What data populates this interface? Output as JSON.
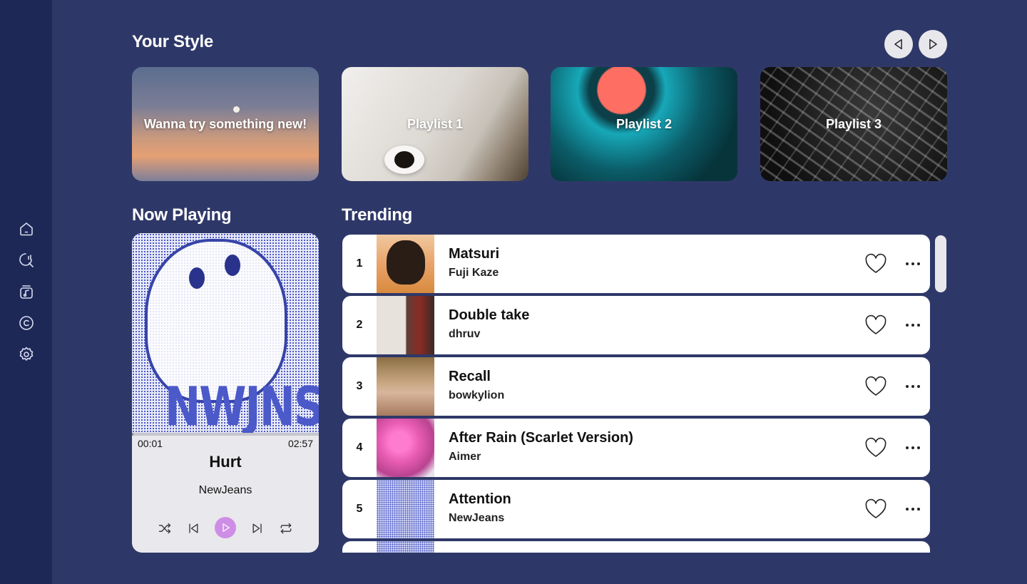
{
  "sidebar": {
    "items": [
      {
        "icon": "home-icon"
      },
      {
        "icon": "search-icon"
      },
      {
        "icon": "music-library-icon"
      },
      {
        "icon": "copyright-icon"
      },
      {
        "icon": "settings-icon"
      }
    ]
  },
  "your_style": {
    "title": "Your Style",
    "cards": [
      {
        "label": "Wanna try something new!"
      },
      {
        "label": "Playlist 1"
      },
      {
        "label": "Playlist 2"
      },
      {
        "label": "Playlist 3"
      }
    ]
  },
  "now_playing": {
    "title": "Now Playing",
    "album_text": "NWJNS",
    "current_time": "00:01",
    "duration": "02:57",
    "progress": 0.006,
    "track": "Hurt",
    "artist": "NewJeans"
  },
  "trending": {
    "title": "Trending",
    "rows": [
      {
        "rank": "1",
        "title": "Matsuri",
        "artist": "Fuji Kaze"
      },
      {
        "rank": "2",
        "title": "Double take",
        "artist": "dhruv"
      },
      {
        "rank": "3",
        "title": "Recall",
        "artist": "bowkylion"
      },
      {
        "rank": "4",
        "title": "After Rain (Scarlet Version)",
        "artist": "Aimer"
      },
      {
        "rank": "5",
        "title": "Attention",
        "artist": "NewJeans"
      },
      {
        "rank": "",
        "title": "",
        "artist": ""
      }
    ]
  },
  "colors": {
    "background": "#2e3868",
    "sidebar": "#1e2856",
    "accent_play": "#cf8ee6"
  }
}
